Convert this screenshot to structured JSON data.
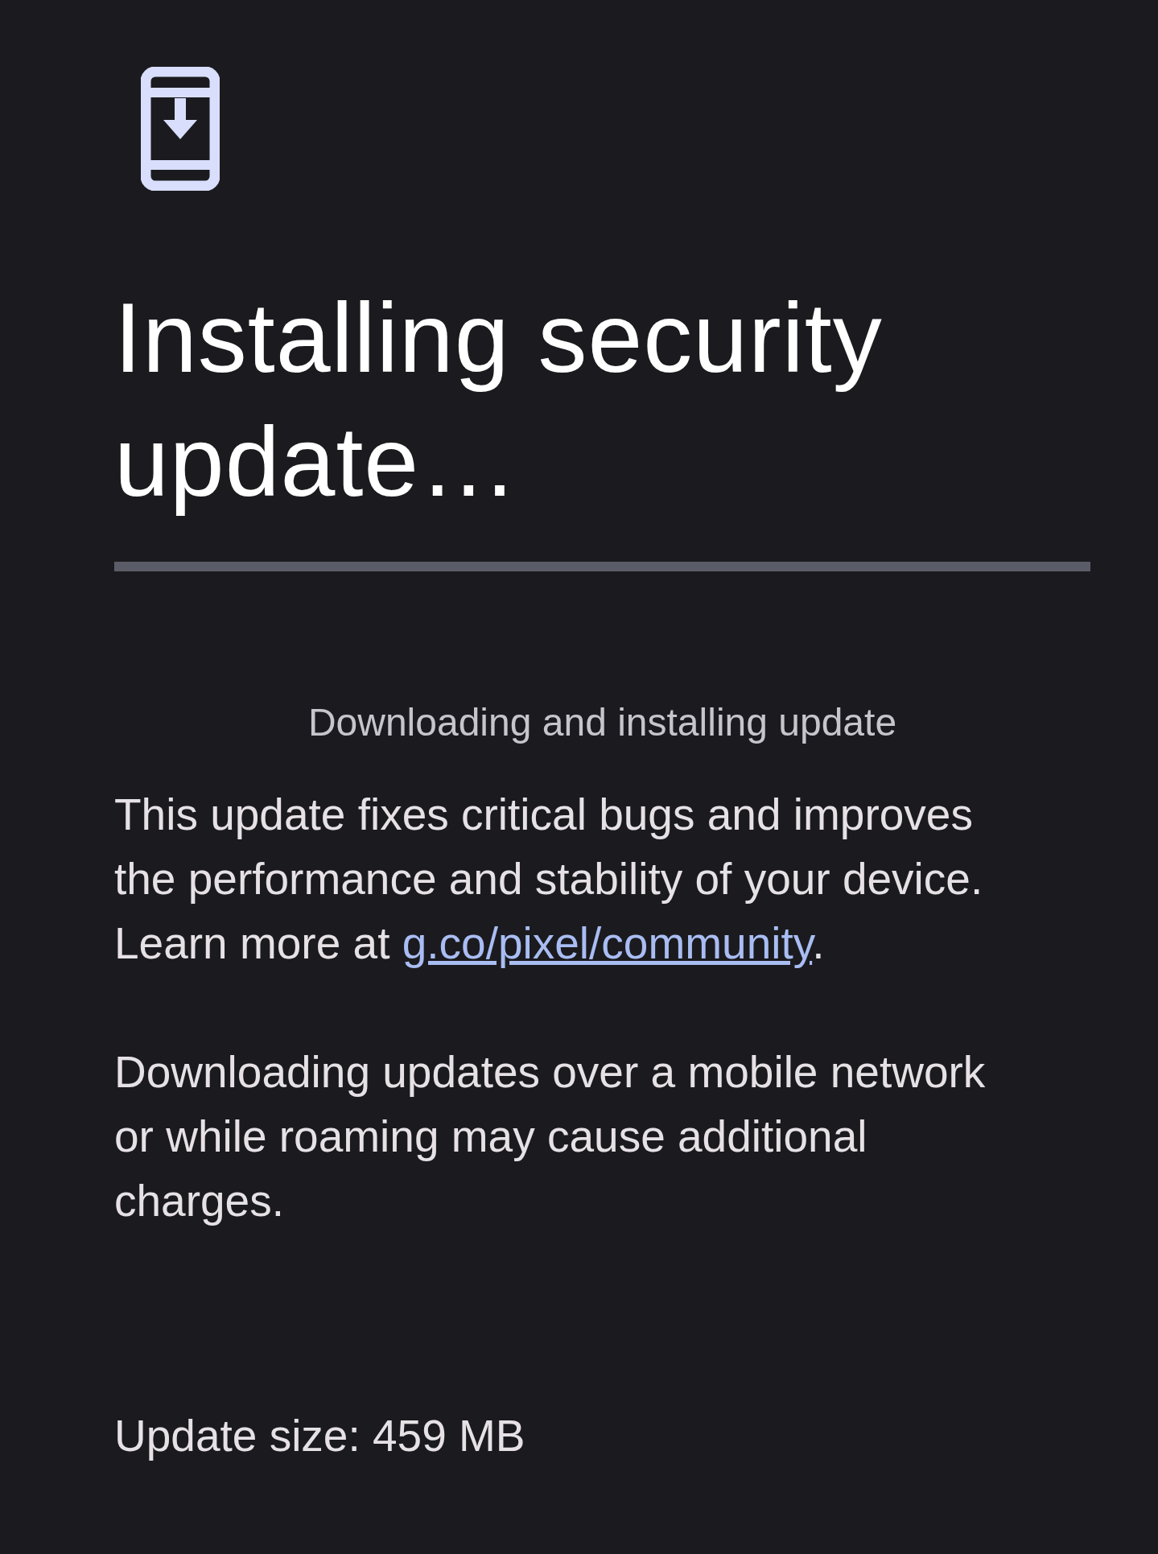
{
  "title": "Installing security update…",
  "progress": {
    "level": 0
  },
  "status": "Downloading and installing update",
  "description": {
    "before": "This update fixes critical bugs and improves the performance and stability of your device. Learn more at ",
    "link": "g.co/pixel/community",
    "after": "."
  },
  "notice": "Downloading updates over a mobile network or while roaming may cause additional charges.",
  "update_size": "Update size: 459 MB"
}
